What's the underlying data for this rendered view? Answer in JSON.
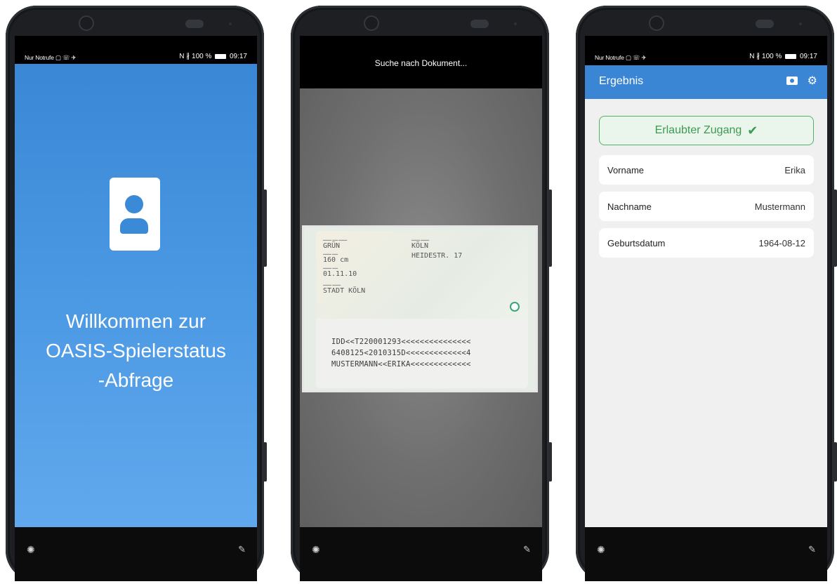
{
  "phone1": {
    "status_left": "Nur Notrufe ▢ ☏ ✈",
    "status_right": "N ∦ 100 %",
    "status_time": "09:17",
    "welcome_line1": "Willkommen zur",
    "welcome_line2": "OASIS-Spielerstatus",
    "welcome_line3": "-Abfrage",
    "bottom_left_icon": "brightness-icon",
    "bottom_right_icon": "pen-icon"
  },
  "phone2": {
    "scan_title": "Suche nach Dokument...",
    "id_fields": {
      "eyes": "GRÜN",
      "height": "160 cm",
      "issued": "01.11.10",
      "authority": "STADT KÖLN",
      "city": "KÖLN",
      "street": "HEIDESTR. 17"
    },
    "mrz": [
      "IDD<<T220001293<<<<<<<<<<<<<<<",
      "6408125<2010315D<<<<<<<<<<<<<4",
      "MUSTERMANN<<ERIKA<<<<<<<<<<<<<"
    ]
  },
  "phone3": {
    "status_left": "Nur Notrufe ▢ ☏ ✈",
    "status_right": "N ∦ 100 %",
    "status_time": "09:17",
    "app_title": "Ergebnis",
    "access_label": "Erlaubter Zugang",
    "rows": [
      {
        "label": "Vorname",
        "value": "Erika"
      },
      {
        "label": "Nachname",
        "value": "Mustermann"
      },
      {
        "label": "Geburtsdatum",
        "value": "1964-08-12"
      }
    ],
    "accent_color": "#3a86d4",
    "success_color": "#3d9a51"
  }
}
